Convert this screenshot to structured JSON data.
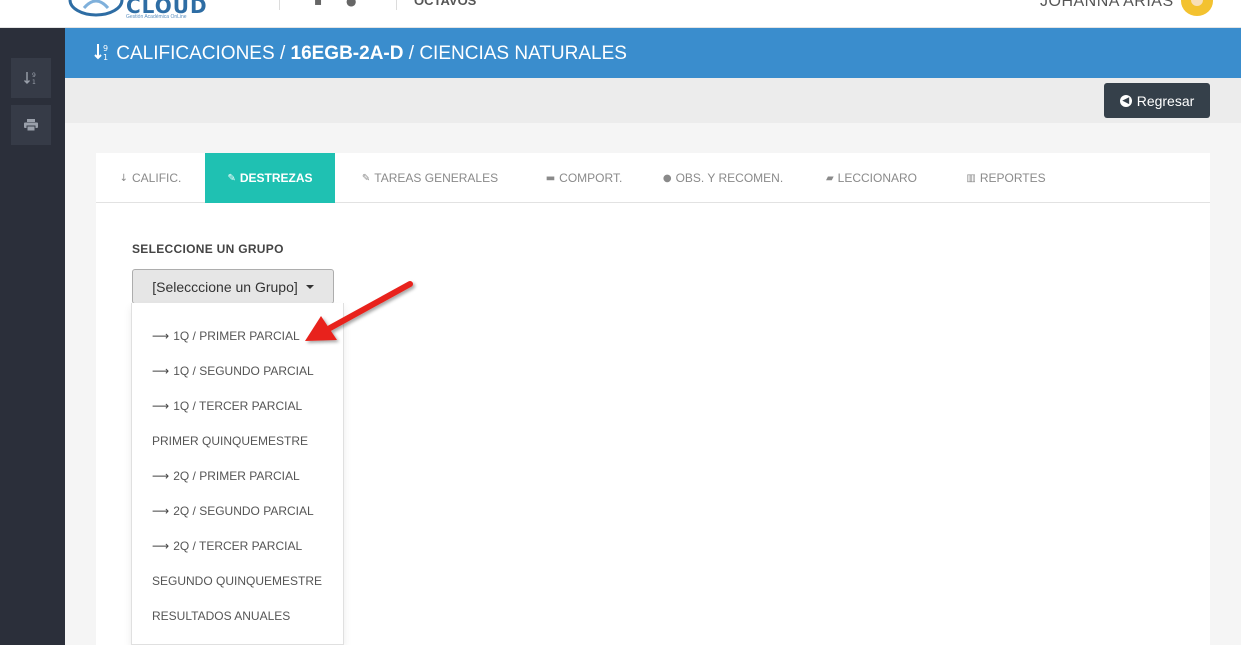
{
  "topbar": {
    "logo_text": "CLOUD",
    "logo_tagline": "Gestión Académica OnLine",
    "link_label": "OCTAVOS",
    "user_name": "JOHANNA ARIAS"
  },
  "header": {
    "section": "CALIFICACIONES",
    "separator": "/",
    "course": "16EGB-2A-D",
    "subject": "CIENCIAS NATURALES"
  },
  "actions": {
    "back_label": "Regresar"
  },
  "tabs": [
    {
      "label": "CALIFIC.",
      "icon": "sort-numeric-icon"
    },
    {
      "label": "DESTREZAS",
      "icon": "edit-icon",
      "active": true
    },
    {
      "label": "TAREAS GENERALES",
      "icon": "edit-icon"
    },
    {
      "label": "COMPORT.",
      "icon": "comment-icon"
    },
    {
      "label": "OBS. Y RECOMEN.",
      "icon": "comments-icon"
    },
    {
      "label": "LECCIONARO",
      "icon": "book-icon"
    },
    {
      "label": "REPORTES",
      "icon": "bar-chart-icon"
    }
  ],
  "group_select": {
    "label": "SELECCIONE UN GRUPO",
    "button_label": "[Selecccione un Grupo]",
    "options": [
      {
        "label": "1Q / PRIMER PARCIAL",
        "arrow": true
      },
      {
        "label": "1Q / SEGUNDO PARCIAL",
        "arrow": true
      },
      {
        "label": "1Q / TERCER PARCIAL",
        "arrow": true
      },
      {
        "label": "PRIMER QUINQUEMESTRE",
        "arrow": false
      },
      {
        "label": "2Q / PRIMER PARCIAL",
        "arrow": true
      },
      {
        "label": "2Q / SEGUNDO PARCIAL",
        "arrow": true
      },
      {
        "label": "2Q / TERCER PARCIAL",
        "arrow": true
      },
      {
        "label": "SEGUNDO QUINQUEMESTRE",
        "arrow": false
      },
      {
        "label": "RESULTADOS ANUALES",
        "arrow": false
      }
    ]
  },
  "colors": {
    "header_bg": "#3a8dcd",
    "active_tab": "#1fc1b2",
    "sidebar_bg": "#2b2f3a",
    "back_button": "#35404a",
    "annotation_arrow": "#e8221b"
  }
}
